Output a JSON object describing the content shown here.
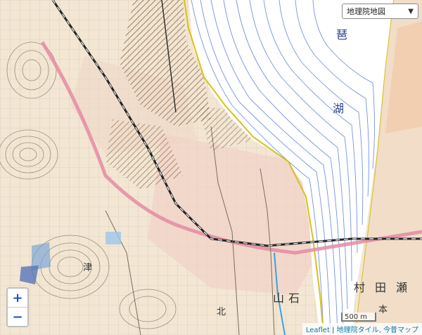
{
  "layer_selector": {
    "selected": "地理院地図",
    "chevron_icon": "chevron-down-icon"
  },
  "zoom": {
    "in_label": "+",
    "out_label": "−"
  },
  "scale": {
    "label": "500 m"
  },
  "attribution": {
    "leaflet": "Leaflet",
    "separator": "|",
    "tiles": "地理院タイル, 今昔マップ"
  },
  "map_labels": {
    "lake_1": "琶",
    "lake_2": "湖",
    "town_1": "本",
    "town_2": "石",
    "town_3": "山",
    "town_4": "村",
    "town_5": "田",
    "town_6": "瀬",
    "town_7": "津",
    "town_8": "北"
  },
  "colors": {
    "land": "#f4ead9",
    "lake": "#ffffff",
    "contour_water": "#4a6ed6",
    "railway": "#222222",
    "road_pink": "#e58aa5"
  }
}
